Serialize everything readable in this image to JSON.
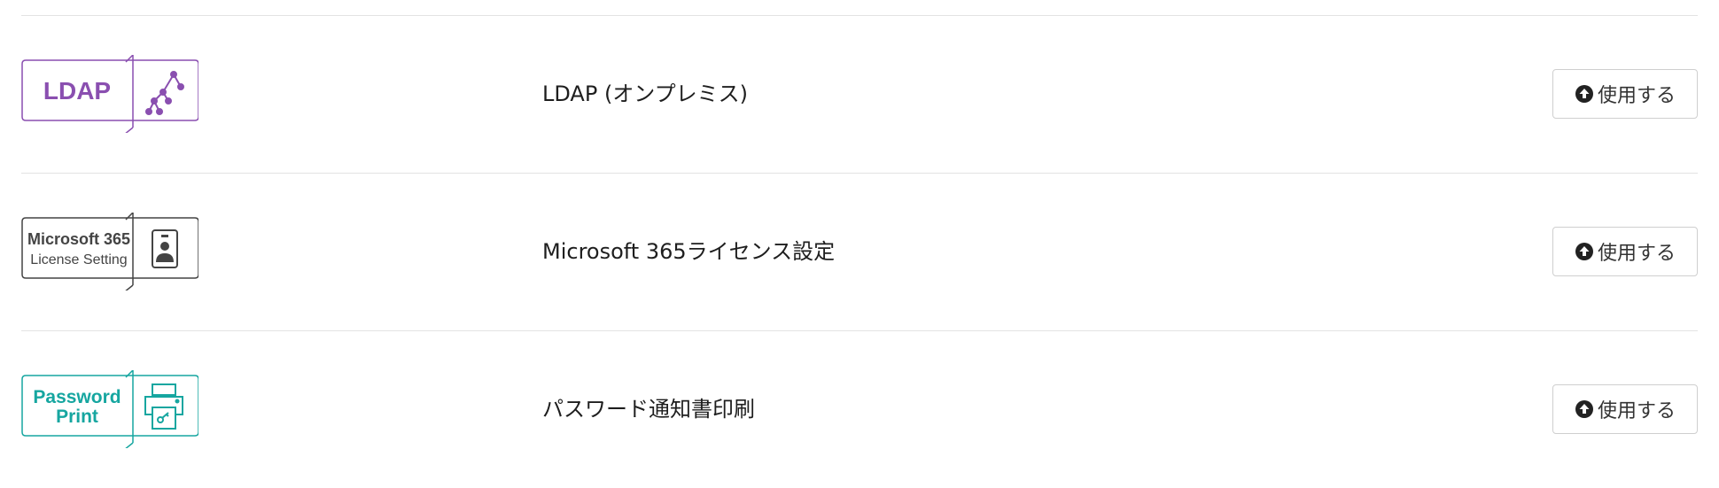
{
  "services": [
    {
      "name": "LDAP (オンプレミス)",
      "logo": {
        "lines": [
          "LDAP"
        ],
        "icon": "tree-network-icon",
        "color": "#8a4fb0"
      },
      "button_label": "使用する"
    },
    {
      "name": "Microsoft 365ライセンス設定",
      "logo": {
        "lines": [
          "Microsoft 365",
          "License Setting"
        ],
        "icon": "id-badge-icon",
        "color": "#444444"
      },
      "button_label": "使用する"
    },
    {
      "name": "パスワード通知書印刷",
      "logo": {
        "lines": [
          "Password",
          "Print"
        ],
        "icon": "printer-key-icon",
        "color": "#16a6a0"
      },
      "button_label": "使用する"
    }
  ],
  "colors": {
    "divider": "#e3e3e3",
    "button_border": "#cfcfcf"
  },
  "icons": {
    "button": "upload-circle-icon"
  }
}
